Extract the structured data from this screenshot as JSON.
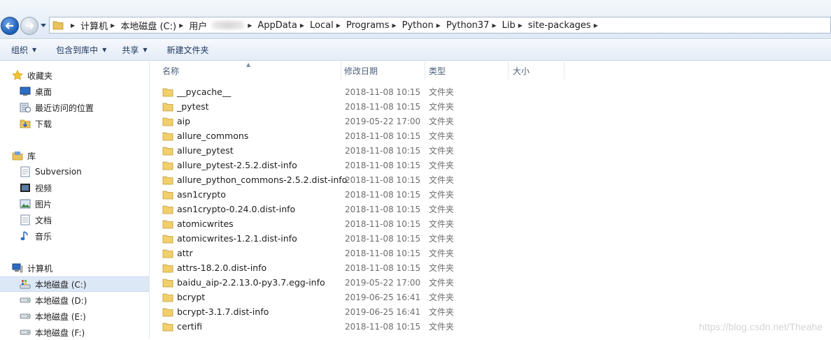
{
  "address": {
    "segments": [
      "计算机",
      "本地磁盘 (C:)",
      "用户",
      "",
      "AppData",
      "Local",
      "Programs",
      "Python",
      "Python37",
      "Lib",
      "site-packages"
    ]
  },
  "toolbar": {
    "organize": "组织",
    "include_in_library": "包含到库中",
    "share": "共享",
    "new_folder": "新建文件夹"
  },
  "nav": {
    "favorites": {
      "label": "收藏夹",
      "items": [
        "桌面",
        "最近访问的位置",
        "下载"
      ]
    },
    "libraries": {
      "label": "库",
      "items": [
        "Subversion",
        "视频",
        "图片",
        "文档",
        "音乐"
      ]
    },
    "computer": {
      "label": "计算机",
      "drives": [
        "本地磁盘 (C:)",
        "本地磁盘 (D:)",
        "本地磁盘 (E:)",
        "本地磁盘 (F:)"
      ]
    }
  },
  "columns": {
    "name": "名称",
    "modified": "修改日期",
    "type": "类型",
    "size": "大小"
  },
  "files": [
    {
      "name": "__pycache__",
      "date": "2018-11-08 10:15",
      "type": "文件夹"
    },
    {
      "name": "_pytest",
      "date": "2018-11-08 10:15",
      "type": "文件夹"
    },
    {
      "name": "aip",
      "date": "2019-05-22 17:00",
      "type": "文件夹"
    },
    {
      "name": "allure_commons",
      "date": "2018-11-08 10:15",
      "type": "文件夹"
    },
    {
      "name": "allure_pytest",
      "date": "2018-11-08 10:15",
      "type": "文件夹"
    },
    {
      "name": "allure_pytest-2.5.2.dist-info",
      "date": "2018-11-08 10:15",
      "type": "文件夹"
    },
    {
      "name": "allure_python_commons-2.5.2.dist-info",
      "date": "2018-11-08 10:15",
      "type": "文件夹"
    },
    {
      "name": "asn1crypto",
      "date": "2018-11-08 10:15",
      "type": "文件夹"
    },
    {
      "name": "asn1crypto-0.24.0.dist-info",
      "date": "2018-11-08 10:15",
      "type": "文件夹"
    },
    {
      "name": "atomicwrites",
      "date": "2018-11-08 10:15",
      "type": "文件夹"
    },
    {
      "name": "atomicwrites-1.2.1.dist-info",
      "date": "2018-11-08 10:15",
      "type": "文件夹"
    },
    {
      "name": "attr",
      "date": "2018-11-08 10:15",
      "type": "文件夹"
    },
    {
      "name": "attrs-18.2.0.dist-info",
      "date": "2018-11-08 10:15",
      "type": "文件夹"
    },
    {
      "name": "baidu_aip-2.2.13.0-py3.7.egg-info",
      "date": "2019-05-22 17:00",
      "type": "文件夹"
    },
    {
      "name": "bcrypt",
      "date": "2019-06-25 16:41",
      "type": "文件夹"
    },
    {
      "name": "bcrypt-3.1.7.dist-info",
      "date": "2019-06-25 16:41",
      "type": "文件夹"
    },
    {
      "name": "certifi",
      "date": "2018-11-08 10:15",
      "type": "文件夹"
    }
  ],
  "watermark": "https://blog.csdn.net/Theahe"
}
